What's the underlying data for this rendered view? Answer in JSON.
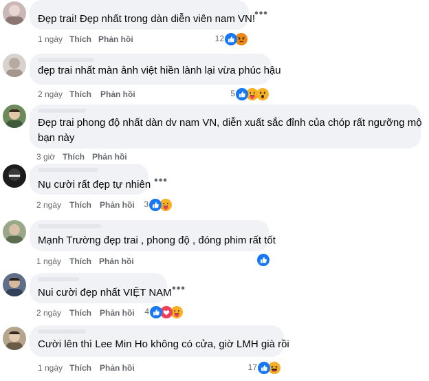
{
  "comments": [
    {
      "text": "Đẹp trai! Đẹp nhất trong dàn diễn viên nam VN!",
      "time": "1 ngày",
      "like": "Thích",
      "reply": "Phản hồi",
      "count": "12",
      "reactions": [
        "like-reaction-icon",
        "angry-reaction-icon"
      ]
    },
    {
      "text": "đẹp trai nhất màn ảnh việt hiền lành lại vừa phúc hậu",
      "time": "2 ngày",
      "like": "Thích",
      "reply": "Phản hồi",
      "count": "5",
      "reactions": [
        "like-reaction-icon",
        "care-reaction-icon",
        "wow-reaction-icon"
      ]
    },
    {
      "text_line1": "Đẹp trai phong độ nhất dàn dv nam VN, diễn xuất sắc đỉnh của chóp rất ngưỡng mộ",
      "text_line2": "bạn này",
      "time": "3 giờ",
      "like": "Thích",
      "reply": "Phản hồi"
    },
    {
      "text": "Nụ cười rất đẹp tự nhiên",
      "time": "2 ngày",
      "like": "Thích",
      "reply": "Phản hồi",
      "count": "3",
      "reactions": [
        "like-reaction-icon",
        "care-reaction-icon"
      ]
    },
    {
      "text": "Mạnh Trường đẹp trai , phong độ , đóng phim rất tốt",
      "time": "1 ngày",
      "like": "Thích",
      "reply": "Phản hồi",
      "reactions": [
        "like-reaction-icon"
      ]
    },
    {
      "text": "Nui cười đẹp nhất VIỆT NAM",
      "time": "2 ngày",
      "like": "Thích",
      "reply": "Phản hồi",
      "count": "4",
      "reactions": [
        "like-reaction-icon",
        "love-reaction-icon",
        "care-reaction-icon"
      ]
    },
    {
      "text": "Cười lên thì Lee Min Ho không có cửa, giờ LMH già rồi",
      "time": "1 ngày",
      "like": "Thích",
      "reply": "Phản hồi",
      "count": "17",
      "reactions": [
        "like-reaction-icon",
        "haha-reaction-icon"
      ]
    }
  ],
  "more_glyph": "•••",
  "colors": {
    "bubble": "#f0f2f5",
    "meta": "#65676b",
    "like": "#1877f2",
    "angry": "#e9710f",
    "love": "#f33e58",
    "yellow": "#f7b125"
  }
}
